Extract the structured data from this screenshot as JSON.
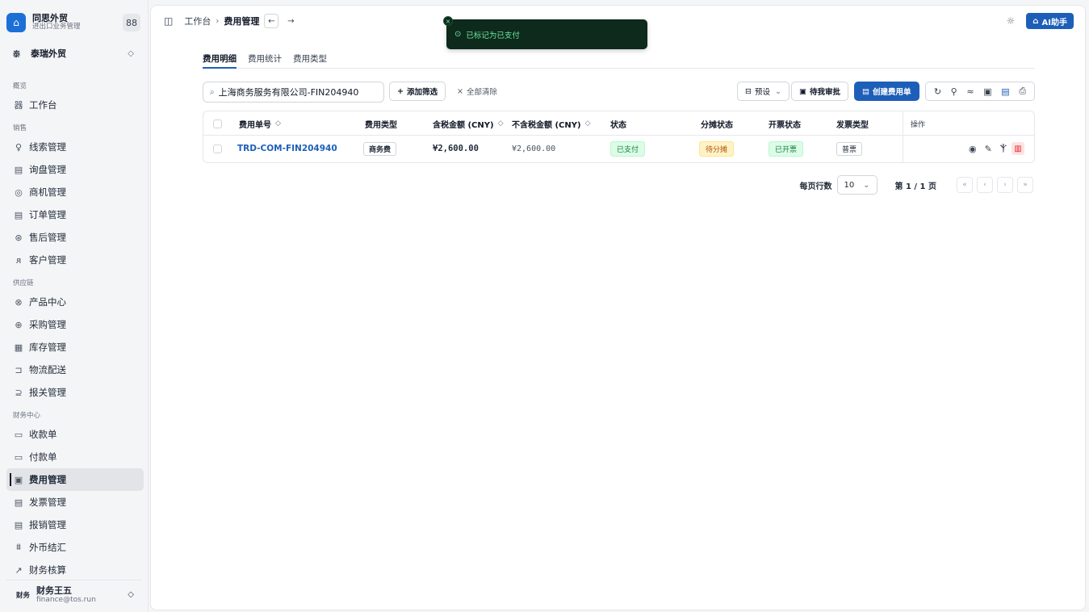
{
  "app": {
    "name": "同思外贸",
    "subtitle": "进出口业务管理",
    "logo_icon": "building-icon",
    "grid_icon": "88"
  },
  "tenant": {
    "badge": "泰",
    "name": "泰瑞外贸"
  },
  "sidebar": {
    "sections": [
      {
        "title": "概览",
        "items": [
          {
            "icon": "器",
            "label": "工作台"
          }
        ]
      },
      {
        "title": "销售",
        "items": [
          {
            "icon": "♀",
            "label": "线索管理"
          },
          {
            "icon": "▤",
            "label": "询盘管理"
          },
          {
            "icon": "◎",
            "label": "商机管理"
          },
          {
            "icon": "▤",
            "label": "订单管理"
          },
          {
            "icon": "⊛",
            "label": "售后管理"
          },
          {
            "icon": "ᴙ",
            "label": "客户管理"
          }
        ]
      },
      {
        "title": "供应链",
        "items": [
          {
            "icon": "⊗",
            "label": "产品中心"
          },
          {
            "icon": "⊕",
            "label": "采购管理"
          },
          {
            "icon": "▦",
            "label": "库存管理"
          },
          {
            "icon": "⊐",
            "label": "物流配送"
          },
          {
            "icon": "⊇",
            "label": "报关管理"
          }
        ]
      },
      {
        "title": "财务中心",
        "items": [
          {
            "icon": "▭",
            "label": "收款单"
          },
          {
            "icon": "▭",
            "label": "付款单"
          },
          {
            "icon": "▣",
            "label": "费用管理",
            "active": true
          },
          {
            "icon": "▤",
            "label": "发票管理"
          },
          {
            "icon": "▤",
            "label": "报销管理"
          },
          {
            "icon": "⩩",
            "label": "外币结汇"
          },
          {
            "icon": "↗",
            "label": "财务核算"
          }
        ]
      }
    ]
  },
  "user": {
    "role": "财务",
    "name": "财务王五",
    "email": "finance@tos.run"
  },
  "breadcrumb": {
    "root": "工作台",
    "current": "费用管理"
  },
  "topbar": {
    "ai_label": "AI助手"
  },
  "toast": {
    "message": "已标记为已支付"
  },
  "tabs": [
    {
      "label": "费用明细",
      "active": true
    },
    {
      "label": "费用统计"
    },
    {
      "label": "费用类型"
    }
  ],
  "toolbar": {
    "search_value": "上海商务服务有限公司-FIN204940",
    "add_filter": "添加筛选",
    "clear_all": "全部清除",
    "preset": "预设",
    "pending": "待我审批",
    "create": "创建费用单"
  },
  "table": {
    "headers": {
      "number": "费用单号",
      "type": "费用类型",
      "tax_incl": "含税金额 (CNY)",
      "tax_excl": "不含税金额 (CNY)",
      "status": "状态",
      "alloc": "分摊状态",
      "invoice": "开票状态",
      "inv_type": "发票类型",
      "ops": "操作"
    },
    "rows": [
      {
        "number": "TRD-COM-FIN204940",
        "type": "商务费",
        "tax_incl": "¥2,600.00",
        "tax_excl": "¥2,600.00",
        "status": "已支付",
        "alloc": "待分摊",
        "invoice": "已开票",
        "inv_type": "普票"
      }
    ]
  },
  "pagination": {
    "label": "每页行数",
    "page_size": "10",
    "page_info": "第 1 / 1 页"
  },
  "colors": {
    "primary": "#1d5fb8",
    "toast_bg": "#0d2a1c",
    "toast_text": "#6ee7a0"
  }
}
